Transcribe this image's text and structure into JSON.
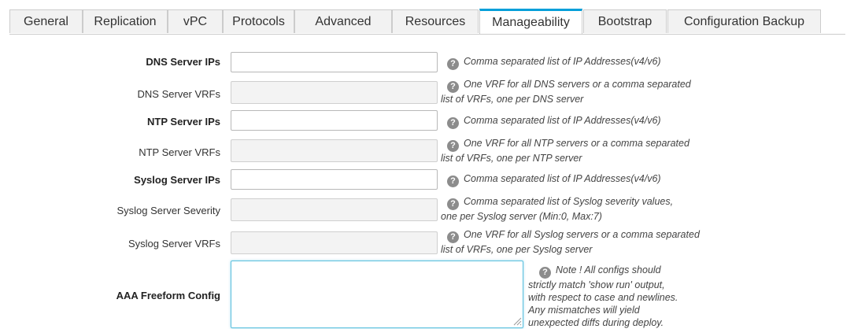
{
  "tabs": [
    {
      "label": "General",
      "active": false
    },
    {
      "label": "Replication",
      "active": false
    },
    {
      "label": "vPC",
      "active": false
    },
    {
      "label": "Protocols",
      "active": false
    },
    {
      "label": "Advanced",
      "active": false
    },
    {
      "label": "Resources",
      "active": false
    },
    {
      "label": "Manageability",
      "active": true
    },
    {
      "label": "Bootstrap",
      "active": false
    },
    {
      "label": "Configuration Backup",
      "active": false
    }
  ],
  "help_icon": "question-circle-icon",
  "accent_color": "#049fd9",
  "fields": {
    "dns_ips": {
      "label": "DNS Server IPs",
      "value": "",
      "help": "Comma separated list of IP Addresses(v4/v6)"
    },
    "dns_vrfs": {
      "label": "DNS Server VRFs",
      "value": "",
      "help_line1": "One VRF for all DNS servers or a comma separated",
      "help_line2": "list of VRFs, one per DNS server"
    },
    "ntp_ips": {
      "label": "NTP Server IPs",
      "value": "",
      "help": "Comma separated list of IP Addresses(v4/v6)"
    },
    "ntp_vrfs": {
      "label": "NTP Server VRFs",
      "value": "",
      "help_line1": "One VRF for all NTP servers or a comma separated",
      "help_line2": "list of VRFs, one per NTP server"
    },
    "syslog_ips": {
      "label": "Syslog Server IPs",
      "value": "",
      "help": "Comma separated list of IP Addresses(v4/v6)"
    },
    "syslog_severity": {
      "label": "Syslog Server Severity",
      "value": "",
      "help_line1": "Comma separated list of Syslog severity values,",
      "help_line2": "one per Syslog server (Min:0, Max:7)"
    },
    "syslog_vrfs": {
      "label": "Syslog Server VRFs",
      "value": "",
      "help_line1": "One VRF for all Syslog servers or a comma separated",
      "help_line2": "list of VRFs, one per Syslog server"
    },
    "aaa_config": {
      "label": "AAA Freeform Config",
      "value": "",
      "help_lines": [
        "Note ! All configs should",
        "strictly match 'show run' output,",
        "with respect to case and newlines.",
        "Any mismatches will yield",
        "unexpected diffs during deploy."
      ]
    }
  }
}
